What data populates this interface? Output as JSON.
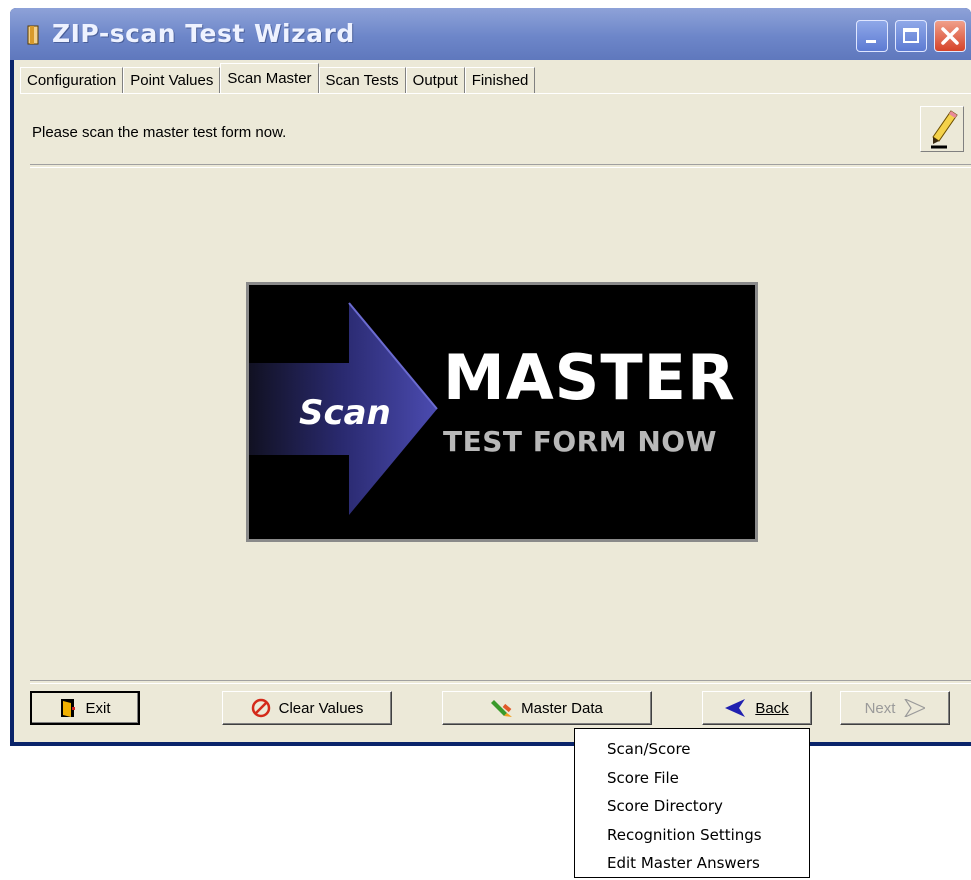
{
  "window": {
    "title": "ZIP-scan Test Wizard",
    "controls": [
      "minimize",
      "maximize",
      "close"
    ]
  },
  "tabs": [
    {
      "label": "Configuration"
    },
    {
      "label": "Point Values"
    },
    {
      "label": "Scan Master",
      "active": true
    },
    {
      "label": "Scan Tests"
    },
    {
      "label": "Output"
    },
    {
      "label": "Finished"
    }
  ],
  "main": {
    "prompt": "Please scan the master test form now.",
    "banner": {
      "scan": "Scan",
      "master": "MASTER",
      "subtitle": "TEST FORM NOW"
    }
  },
  "buttons": {
    "exit": "Exit",
    "clear_values": "Clear Values",
    "master_data": "Master Data",
    "back": "Back",
    "next": "Next"
  },
  "dropdown": {
    "items": [
      "Scan/Score",
      "Score File",
      "Score Directory",
      "Recognition Settings",
      "Edit Master Answers"
    ]
  },
  "colors": {
    "titlebar": "#7a90cf",
    "client_bg": "#ece9d8",
    "close_button": "#d6432a",
    "clear_icon": "#d42a1a",
    "back_arrow": "#2020b0"
  }
}
